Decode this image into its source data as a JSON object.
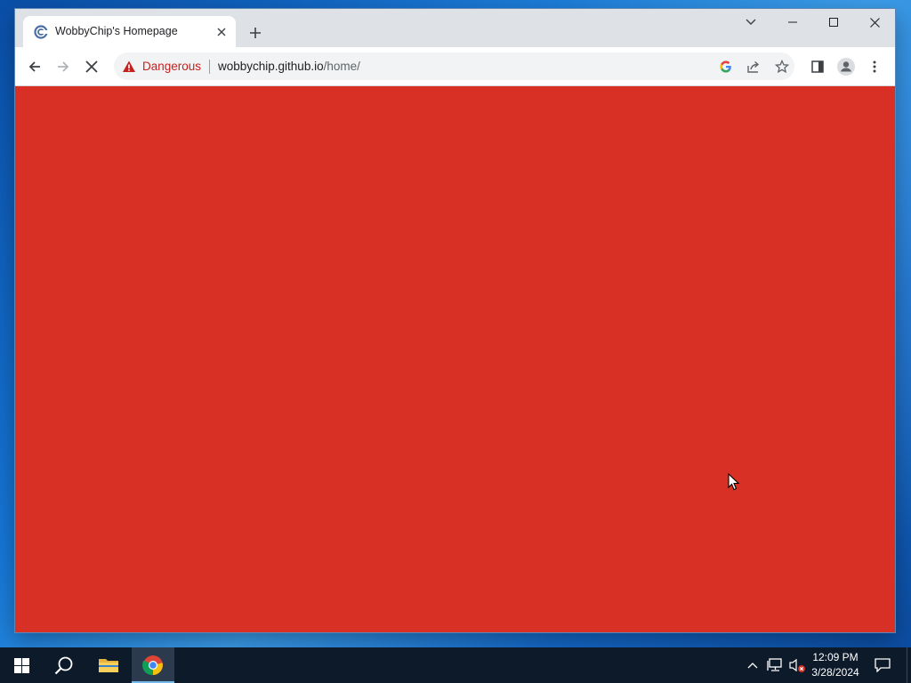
{
  "browser": {
    "tab": {
      "title": "WobbyChip's Homepage"
    },
    "omnibox": {
      "security_label": "Dangerous",
      "url_host": "wobbychip.github.io",
      "url_path": "/home/"
    },
    "page": {
      "background_color": "#d93025"
    }
  },
  "taskbar": {
    "time": "12:09 PM",
    "date": "3/28/2024",
    "pinned": [
      "windows-start",
      "search",
      "file-explorer",
      "google-chrome"
    ]
  },
  "colors": {
    "danger": "#c5221f",
    "page_red": "#d93025",
    "taskbar": "#0d1a2a"
  }
}
